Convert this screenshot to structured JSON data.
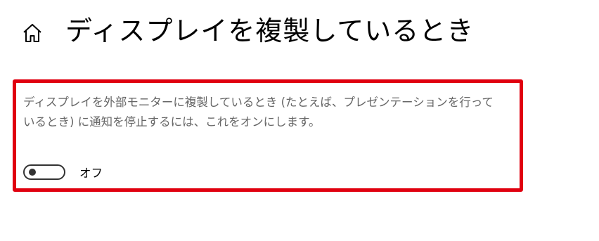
{
  "header": {
    "title": "ディスプレイを複製しているとき",
    "home_icon": "home-icon"
  },
  "setting": {
    "description": "ディスプレイを外部モニターに複製しているとき (たとえば、プレゼンテーションを行っているとき) に通知を停止するには、これをオンにします。",
    "toggle_state_label": "オフ",
    "toggle_on": false
  },
  "colors": {
    "highlight_border": "#e0000f",
    "description_text": "#666666",
    "toggle": "#333333"
  }
}
